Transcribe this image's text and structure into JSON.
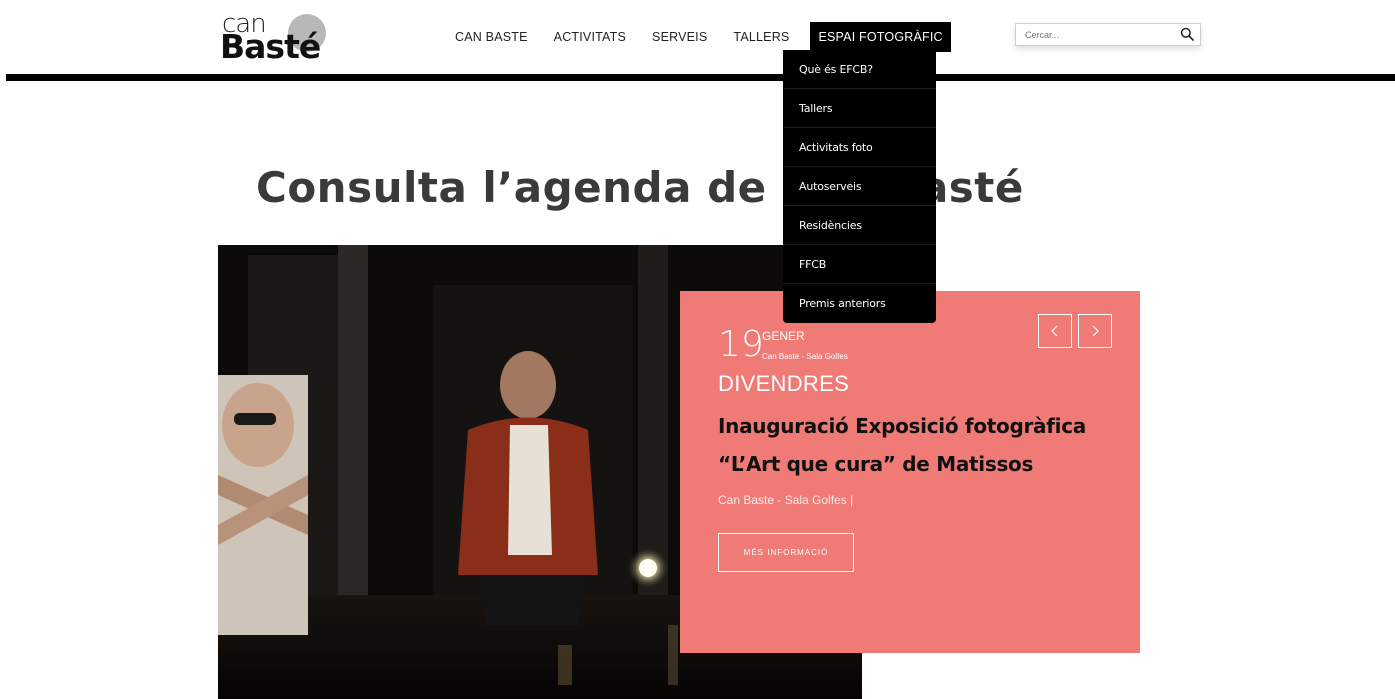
{
  "brand": {
    "line1": "can",
    "line2": "Basté"
  },
  "nav": {
    "items": [
      {
        "label": "CAN BASTE"
      },
      {
        "label": "ACTIVITATS"
      },
      {
        "label": "SERVEIS"
      },
      {
        "label": "TALLERS"
      },
      {
        "label": "ESPAI FOTOGRÀFIC"
      }
    ]
  },
  "search": {
    "placeholder": "Cercar...",
    "icon": "search-icon"
  },
  "dropdown": {
    "items": [
      {
        "label": "Què és EFCB?"
      },
      {
        "label": "Tallers"
      },
      {
        "label": "Activitats foto"
      },
      {
        "label": "Autoserveis"
      },
      {
        "label": "Residències"
      },
      {
        "label": "FFCB"
      },
      {
        "label": "Premis anteriors"
      }
    ]
  },
  "page": {
    "heading": "Consulta l’agenda de Can Basté"
  },
  "event": {
    "day": "19",
    "month": "GENER",
    "venue_short": "Can Baste - Sala Golfes",
    "weekday": "DIVENDRES",
    "title": "Inauguració Exposició fotogràfica “L’Art que cura” de Matissos",
    "venue": "Can Baste - Sala Golfes |",
    "more_label": "MÉS INFORMACIÓ"
  },
  "colors": {
    "card": "#f07a76",
    "text_dark": "#111111",
    "nav_active_bg": "#000000"
  }
}
